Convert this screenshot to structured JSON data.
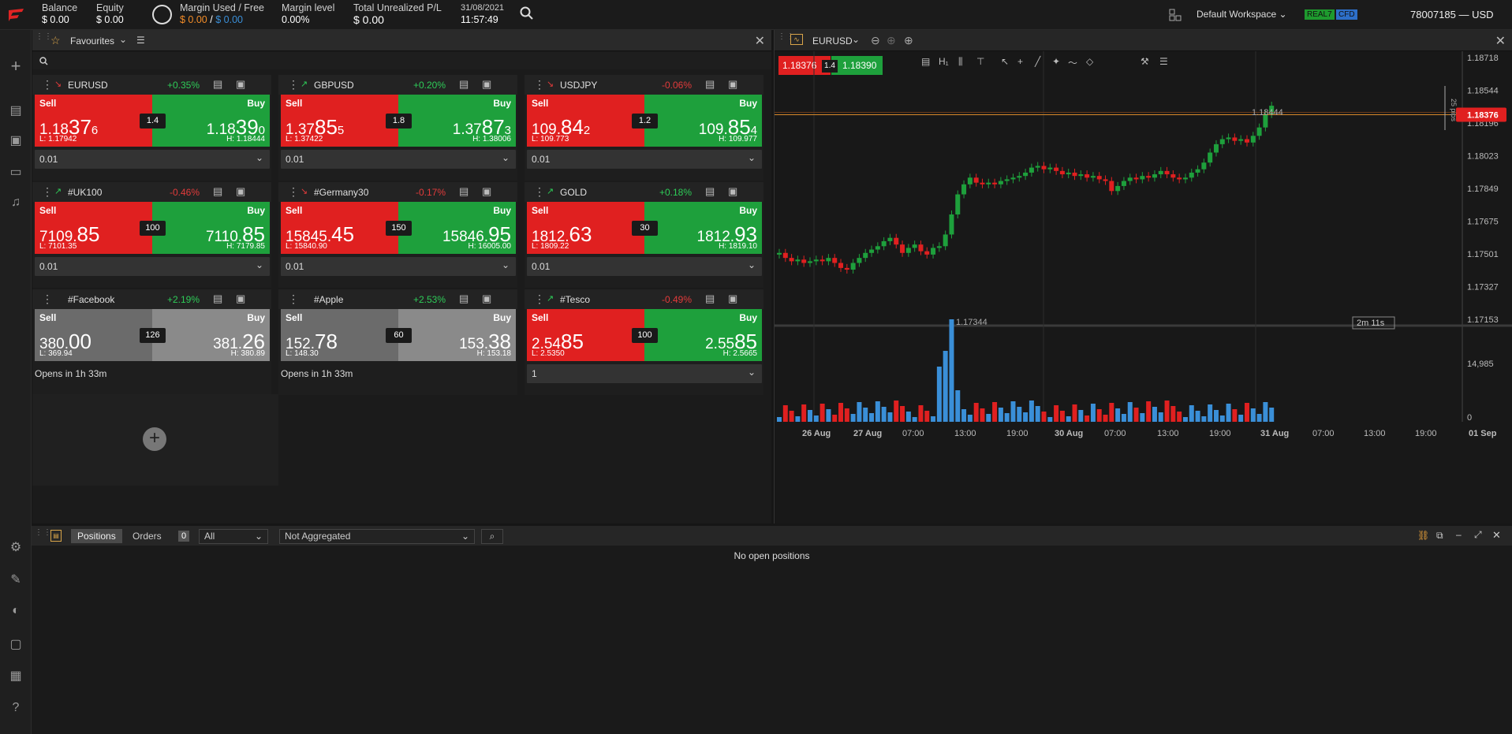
{
  "header": {
    "balance": {
      "label": "Balance",
      "value": "$ 0.00"
    },
    "equity": {
      "label": "Equity",
      "value": "$ 0.00"
    },
    "margin": {
      "label": "Margin Used / Free",
      "used": "$ 0.00",
      "sep": "/",
      "free": "$ 0.00"
    },
    "margin_level": {
      "label": "Margin level",
      "value": "0.00%"
    },
    "unrealized": {
      "label": "Total Unrealized P/L",
      "value": "$ 0.00"
    },
    "date": "31/08/2021",
    "time": "11:57:49",
    "workspace": "Default Workspace",
    "badge_real": "REAL7",
    "badge_cfd": "CFD",
    "account": "78007185 — USD"
  },
  "favourites": {
    "title": "Favourites"
  },
  "cards": [
    {
      "name": "EURUSD",
      "change": "+0.35%",
      "dir": "up",
      "arrow": "↘",
      "arrow_color": "dn",
      "sell_label": "Sell",
      "buy_label": "Buy",
      "sell_a": "1.18",
      "sell_b": "37",
      "sell_c": "6",
      "buy_a": "1.18",
      "buy_b": "39",
      "buy_c": "0",
      "spread": "1.4",
      "low": "L: 1.17942",
      "high": "H: 1.18444",
      "qty": "0.01",
      "gray": false
    },
    {
      "name": "GBPUSD",
      "change": "+0.20%",
      "dir": "up",
      "arrow": "↗",
      "arrow_color": "up",
      "sell_label": "Sell",
      "buy_label": "Buy",
      "sell_a": "1.37",
      "sell_b": "85",
      "sell_c": "5",
      "buy_a": "1.37",
      "buy_b": "87",
      "buy_c": "3",
      "spread": "1.8",
      "low": "L: 1.37422",
      "high": "H: 1.38006",
      "qty": "0.01",
      "gray": false
    },
    {
      "name": "USDJPY",
      "change": "-0.06%",
      "dir": "dn",
      "arrow": "↘",
      "arrow_color": "dn",
      "sell_label": "Sell",
      "buy_label": "Buy",
      "sell_a": "109.",
      "sell_b": "84",
      "sell_c": "2",
      "buy_a": "109.",
      "buy_b": "85",
      "buy_c": "4",
      "spread": "1.2",
      "low": "L: 109.773",
      "high": "H: 109.977",
      "qty": "0.01",
      "gray": false
    },
    {
      "name": "#UK100",
      "change": "-0.46%",
      "dir": "dn",
      "arrow": "↗",
      "arrow_color": "up",
      "sell_label": "Sell",
      "buy_label": "Buy",
      "sell_a": "7109.",
      "sell_b": "85",
      "sell_c": "",
      "buy_a": "7110.",
      "buy_b": "85",
      "buy_c": "",
      "spread": "100",
      "low": "L: 7101.35",
      "high": "H: 7179.85",
      "qty": "0.01",
      "gray": false
    },
    {
      "name": "#Germany30",
      "change": "-0.17%",
      "dir": "dn",
      "arrow": "↘",
      "arrow_color": "dn",
      "sell_label": "Sell",
      "buy_label": "Buy",
      "sell_a": "15845.",
      "sell_b": "45",
      "sell_c": "",
      "buy_a": "15846.",
      "buy_b": "95",
      "buy_c": "",
      "spread": "150",
      "low": "L: 15840.90",
      "high": "H: 16005.00",
      "qty": "0.01",
      "gray": false
    },
    {
      "name": "GOLD",
      "change": "+0.18%",
      "dir": "up",
      "arrow": "↗",
      "arrow_color": "up",
      "sell_label": "Sell",
      "buy_label": "Buy",
      "sell_a": "1812.",
      "sell_b": "63",
      "sell_c": "",
      "buy_a": "1812.",
      "buy_b": "93",
      "buy_c": "",
      "spread": "30",
      "low": "L: 1809.22",
      "high": "H: 1819.10",
      "qty": "0.01",
      "gray": false
    },
    {
      "name": "#Facebook",
      "change": "+2.19%",
      "dir": "up",
      "arrow": "",
      "arrow_color": "up",
      "sell_label": "Sell",
      "buy_label": "Buy",
      "sell_a": "380.",
      "sell_b": "00",
      "sell_c": "",
      "buy_a": "381.",
      "buy_b": "26",
      "buy_c": "",
      "spread": "126",
      "low": "L: 369.94",
      "high": "H: 380.89",
      "qty": "Opens in 1h 33m",
      "gray": true
    },
    {
      "name": "#Apple",
      "change": "+2.53%",
      "dir": "up",
      "arrow": "",
      "arrow_color": "up",
      "sell_label": "Sell",
      "buy_label": "Buy",
      "sell_a": "152.",
      "sell_b": "78",
      "sell_c": "",
      "buy_a": "153.",
      "buy_b": "38",
      "buy_c": "",
      "spread": "60",
      "low": "L: 148.30",
      "high": "H: 153.18",
      "qty": "Opens in 1h 33m",
      "gray": true
    },
    {
      "name": "#Tesco",
      "change": "-0.49%",
      "dir": "dn",
      "arrow": "↗",
      "arrow_color": "up",
      "sell_label": "Sell",
      "buy_label": "Buy",
      "sell_a": "2.54",
      "sell_b": "85",
      "sell_c": "",
      "buy_a": "2.55",
      "buy_b": "85",
      "buy_c": "",
      "spread": "100",
      "low": "L: 2.5350",
      "high": "H: 2.5665",
      "qty": "1",
      "gray": false
    }
  ],
  "chart": {
    "symbol": "EURUSD",
    "sell_price": "1.18376",
    "spread": "1.4",
    "buy_price": "1.18390",
    "last_price": "1.18376",
    "high_label": "1.18444",
    "low_label": "1.17344",
    "pips_label": "25 pips",
    "countdown": "2m 11s",
    "y_ticks": [
      "1.18718",
      "1.18544",
      "1.18196",
      "1.18023",
      "1.17849",
      "1.17675",
      "1.17501",
      "1.17327",
      "1.17153"
    ],
    "vol_ticks": [
      "14,985",
      "0"
    ],
    "x_ticks": [
      "26 Aug",
      "27 Aug",
      "07:00",
      "13:00",
      "19:00",
      "30 Aug",
      "07:00",
      "13:00",
      "19:00",
      "31 Aug",
      "07:00",
      "13:00",
      "19:00",
      "01 Sep"
    ]
  },
  "positions": {
    "tab_positions": "Positions",
    "tab_orders": "Orders",
    "count": "0",
    "filter": "All",
    "aggregation": "Not Aggregated",
    "empty": "No open positions"
  },
  "colors": {
    "up": "#1ea03c",
    "down": "#e02020",
    "accent": "#e23b3b",
    "blue": "#3a8fd8"
  }
}
